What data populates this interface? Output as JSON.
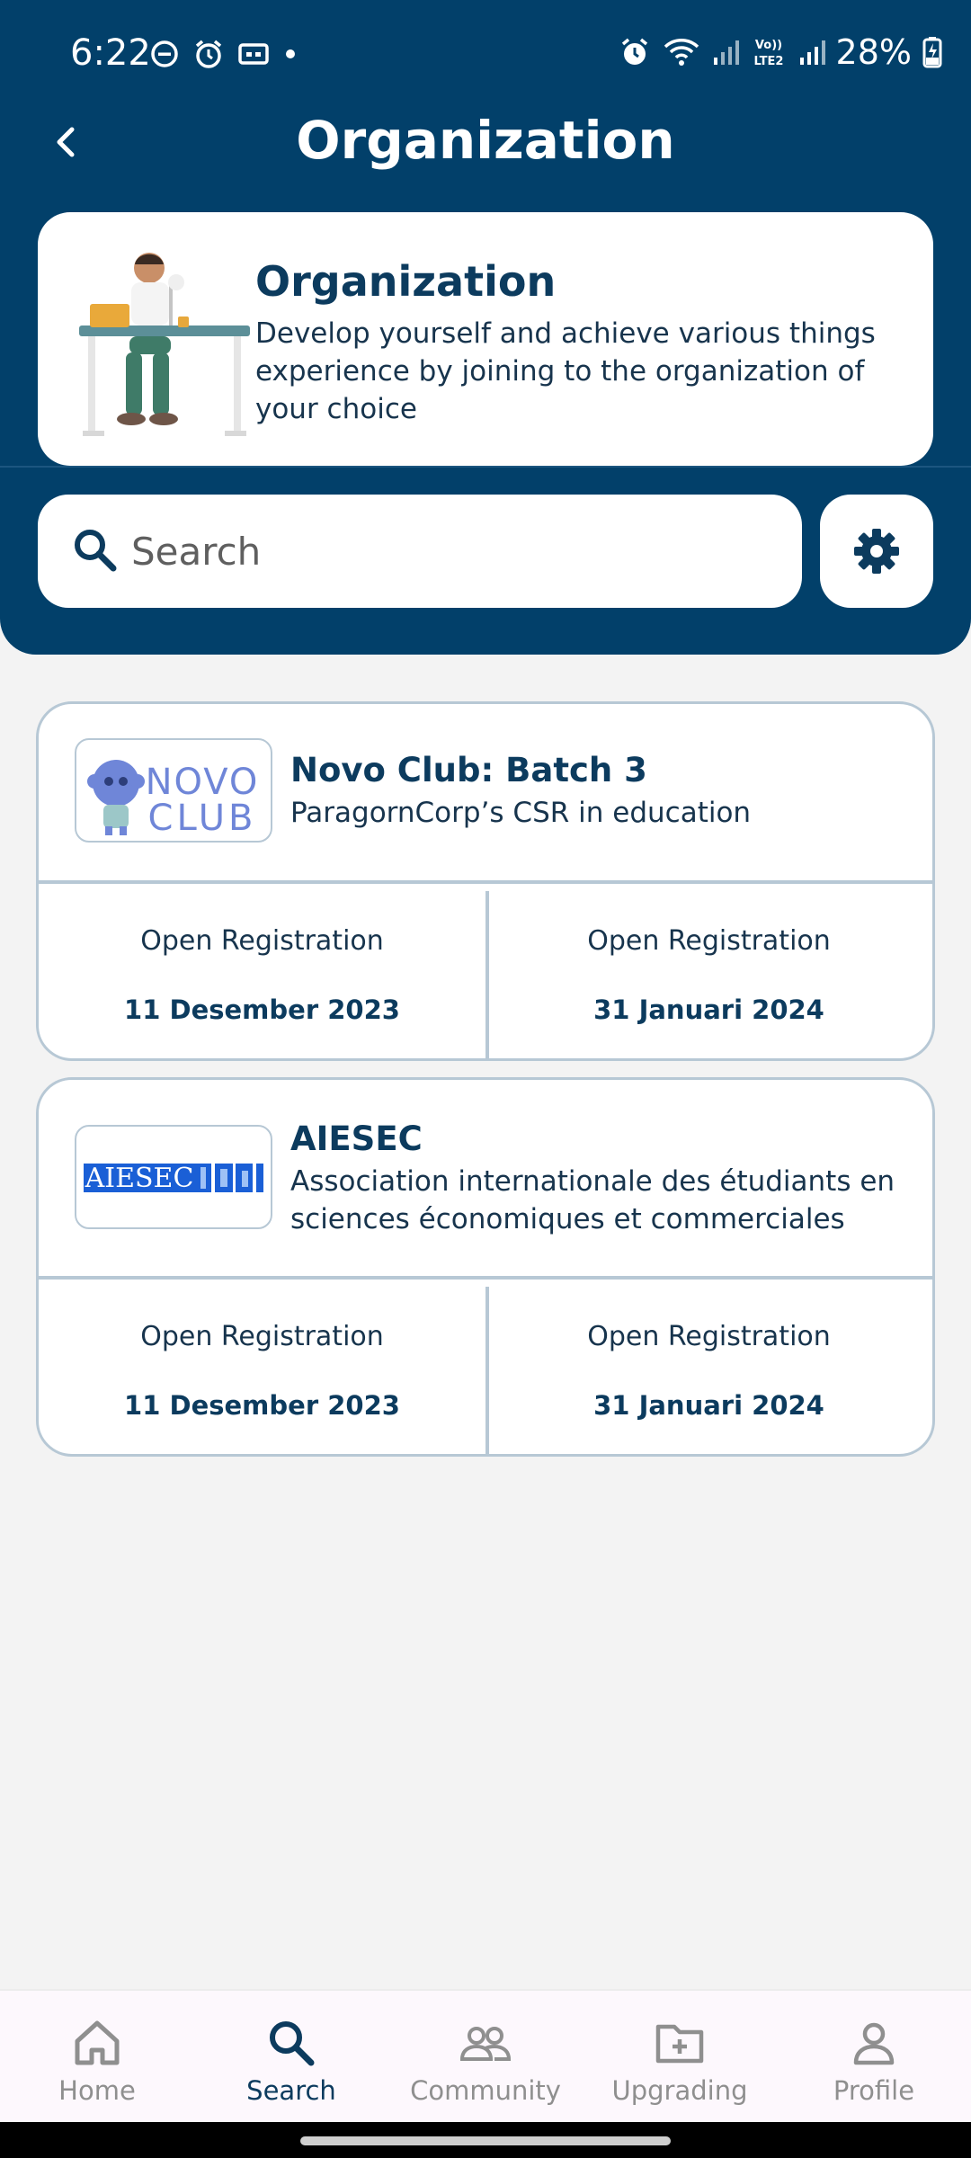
{
  "status_bar": {
    "time": "6:22",
    "battery_percent": "28%",
    "left_icons": [
      "dnd-icon",
      "alarm-icon",
      "cast-icon",
      "dot-icon"
    ],
    "right_icons": [
      "alarm-icon",
      "wifi-icon",
      "signal-icon",
      "volte-icon",
      "signal-icon",
      "battery-charging-icon"
    ]
  },
  "header": {
    "title": "Organization",
    "back_icon": "chevron-left-icon"
  },
  "intro": {
    "title": "Organization",
    "description": "Develop yourself and achieve various things experience by joining to the organization of your choice"
  },
  "search": {
    "placeholder": "Search",
    "value": ""
  },
  "organizations": [
    {
      "name": "Novo Club: Batch 3",
      "description": "ParagornCorp’s CSR in education",
      "logo_text": "NOVO CLUB",
      "registration": [
        {
          "label": "Open Registration",
          "date": "11 Desember 2023"
        },
        {
          "label": "Open Registration",
          "date": "31 Januari 2024"
        }
      ]
    },
    {
      "name": "AIESEC",
      "description": "Association internationale des étudiants en sciences économiques et commerciales",
      "logo_text": "AIESEC",
      "registration": [
        {
          "label": "Open Registration",
          "date": "11 Desember 2023"
        },
        {
          "label": "Open Registration",
          "date": "31 Januari 2024"
        }
      ]
    }
  ],
  "bottom_nav": {
    "items": [
      {
        "label": "Home",
        "icon": "home-icon",
        "active": false
      },
      {
        "label": "Search",
        "icon": "search-icon",
        "active": true
      },
      {
        "label": "Community",
        "icon": "community-icon",
        "active": false
      },
      {
        "label": "Upgrading",
        "icon": "folder-plus-icon",
        "active": false
      },
      {
        "label": "Profile",
        "icon": "profile-icon",
        "active": false
      }
    ]
  },
  "colors": {
    "primary": "#02406a",
    "text_dark": "#0c3b5e",
    "card_border": "#b7c8d5",
    "background": "#f3f3f3"
  }
}
